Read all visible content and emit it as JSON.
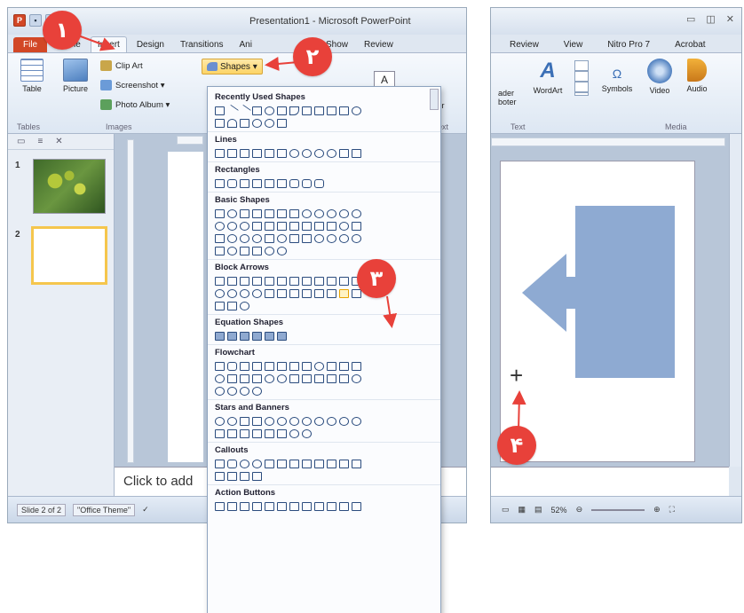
{
  "colors": {
    "accent_red": "#e8413a",
    "file_tab": "#d24726",
    "shape_fill": "#8eaad2"
  },
  "left": {
    "title": "Presentation1 - Microsoft PowerPoint",
    "tabs": [
      "File",
      "Home",
      "Insert",
      "Design",
      "Transitions",
      "Ani",
      "Slide Show",
      "Review"
    ],
    "active_tab": "Insert",
    "ribbon": {
      "table_label": "Table",
      "picture_label": "Picture",
      "clipart_label": "Clip Art",
      "screenshot_label": "Screenshot ▾",
      "photoalbum_label": "Photo Album ▾",
      "shapes_label": "Shapes ▾",
      "group_tables": "Tables",
      "group_images": "Images",
      "textbox_icon": "A",
      "header_fragment": "er",
      "footer_fragment": "oter",
      "text_fragment": "ext"
    },
    "slide_numbers": [
      "1",
      "2"
    ],
    "notes_placeholder": "Click to add",
    "status": {
      "slide": "Slide 2 of 2",
      "theme": "\"Office Theme\""
    }
  },
  "gallery": {
    "categories": [
      "Recently Used Shapes",
      "Lines",
      "Rectangles",
      "Basic Shapes",
      "Block Arrows",
      "Equation Shapes",
      "Flowchart",
      "Stars and Banners",
      "Callouts",
      "Action Buttons"
    ]
  },
  "right": {
    "tabs": [
      "Review",
      "View",
      "Nitro Pro 7",
      "Acrobat"
    ],
    "ribbon": {
      "reader_label": "ader",
      "reader_label2": "boter",
      "wordart_label": "WordArt",
      "symbols_label": "Symbols",
      "video_label": "Video",
      "audio_label": "Audio",
      "group_text": "Text",
      "group_media": "Media"
    },
    "status": {
      "zoom": "52%"
    }
  },
  "steps": [
    "۱",
    "۲",
    "۳",
    "۴"
  ]
}
